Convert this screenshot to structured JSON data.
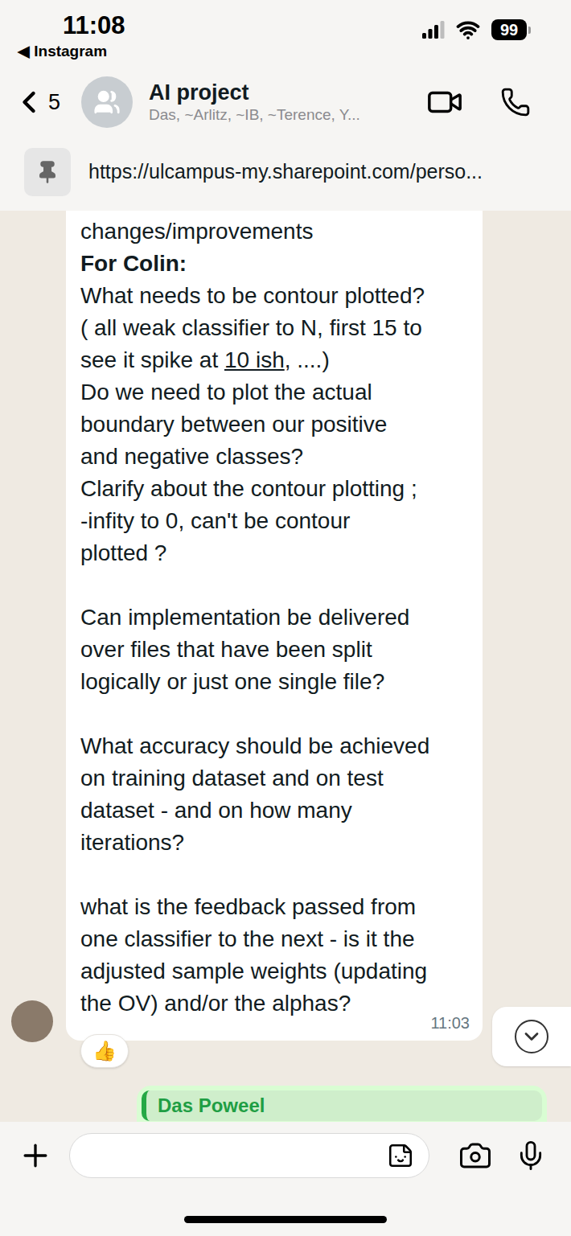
{
  "status_bar": {
    "time": "11:08",
    "back_app": "◀ Instagram",
    "battery": "99"
  },
  "header": {
    "back_count": "5",
    "title": "AI project",
    "subtitle": "Das, ~Arlitz, ~IB, ~Terence, Y..."
  },
  "pinned": {
    "text": "https://ulcampus-my.sharepoint.com/perso..."
  },
  "messages": [
    {
      "kind": "incoming",
      "paragraphs": [
        {
          "heading": "",
          "lines": [
            {
              "text": "changes/improvements",
              "underlined": ""
            }
          ]
        },
        {
          "heading": "For Colin:",
          "lines": [
            {
              "text": "What needs to be contour plotted?",
              "underlined": ""
            },
            {
              "text": "( all weak classifier to N, first 15 to",
              "underlined": ""
            },
            {
              "text": "see it spike at 10 ish, ....)",
              "underlined": "10 ish"
            },
            {
              "text": "Do we need to plot the actual",
              "underlined": ""
            },
            {
              "text": "boundary between our positive",
              "underlined": ""
            },
            {
              "text": "and negative classes?",
              "underlined": ""
            },
            {
              "text": "Clarify about the contour plotting ;",
              "underlined": ""
            },
            {
              "text": "-infity to 0, can't be contour",
              "underlined": ""
            },
            {
              "text": "plotted ?",
              "underlined": ""
            }
          ]
        },
        {
          "heading": "",
          "lines": [
            {
              "text": "Can implementation be delivered",
              "underlined": ""
            },
            {
              "text": "over files that have been split",
              "underlined": ""
            },
            {
              "text": "logically or just one single file?",
              "underlined": ""
            }
          ]
        },
        {
          "heading": "",
          "lines": [
            {
              "text": "What accuracy should be achieved",
              "underlined": ""
            },
            {
              "text": "on training dataset and on test",
              "underlined": ""
            },
            {
              "text": "dataset - and on how many",
              "underlined": ""
            },
            {
              "text": "iterations?",
              "underlined": ""
            }
          ]
        },
        {
          "heading": "",
          "lines": [
            {
              "text": "what is the feedback passed from",
              "underlined": ""
            },
            {
              "text": "one classifier to the next - is it the",
              "underlined": ""
            },
            {
              "text": "adjusted sample weights (updating",
              "underlined": ""
            },
            {
              "text": "the OV) and/or the alphas?",
              "underlined": ""
            }
          ]
        }
      ],
      "time": "11:03",
      "reactions": [
        "👍"
      ],
      "quote_author": ""
    },
    {
      "kind": "outgoing",
      "paragraphs": [],
      "time": "",
      "reactions": [],
      "quote_author": "Das Poweel"
    }
  ]
}
